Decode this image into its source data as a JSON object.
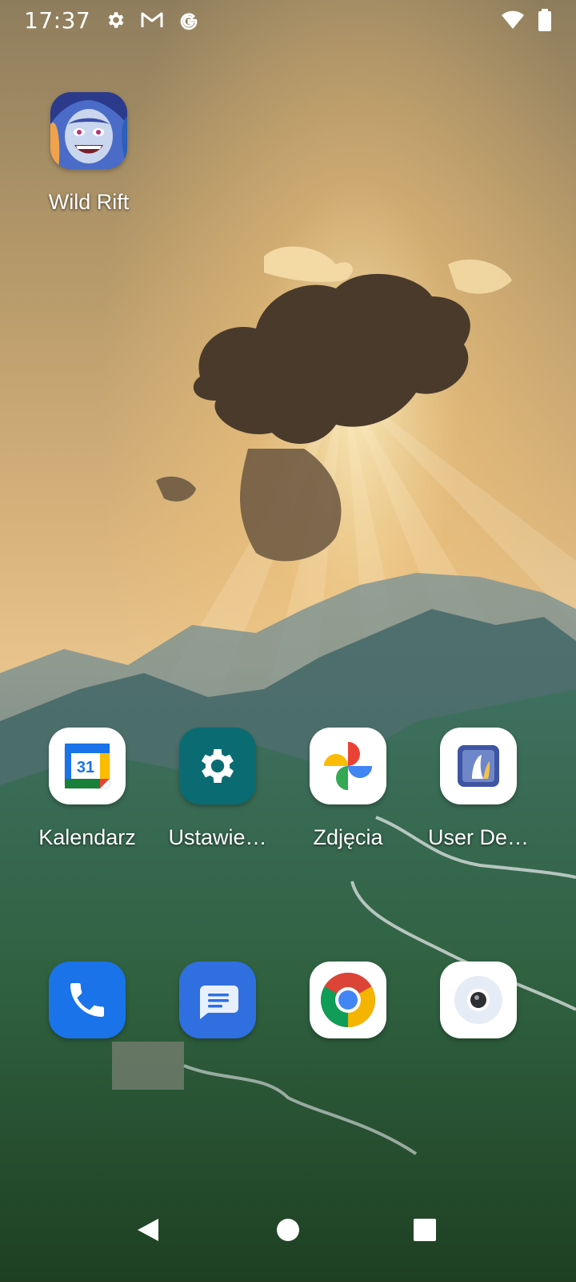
{
  "status_bar": {
    "time": "17:37",
    "left_icons": [
      "gear-icon",
      "gmail-icon",
      "google-icon"
    ],
    "right_icons": [
      "wifi-icon",
      "battery-icon"
    ]
  },
  "home": {
    "top_apps": [
      {
        "label": "Wild Rift",
        "icon": "wild-rift-icon"
      }
    ],
    "apps_row": [
      {
        "label": "Kalendarz",
        "icon": "calendar-icon",
        "calendar_day": "31"
      },
      {
        "label": "Ustawie…",
        "icon": "settings-icon"
      },
      {
        "label": "Zdjęcia",
        "icon": "photos-icon"
      },
      {
        "label": "User De…",
        "icon": "user-dev-icon"
      }
    ],
    "dock": [
      {
        "icon": "phone-icon"
      },
      {
        "icon": "messages-icon"
      },
      {
        "icon": "chrome-icon"
      },
      {
        "icon": "camera-icon"
      }
    ]
  },
  "nav_bar": {
    "buttons": [
      "back-icon",
      "home-icon",
      "recents-icon"
    ]
  },
  "colors": {
    "sky_top": "#9c8a68",
    "sky_glow": "#f5c27a",
    "mountain": "#4f7379",
    "forest": "#2f5a36",
    "settings_teal": "#0b6b73",
    "phone_blue": "#1a73e8",
    "messages_blue": "#2f6fe0"
  }
}
